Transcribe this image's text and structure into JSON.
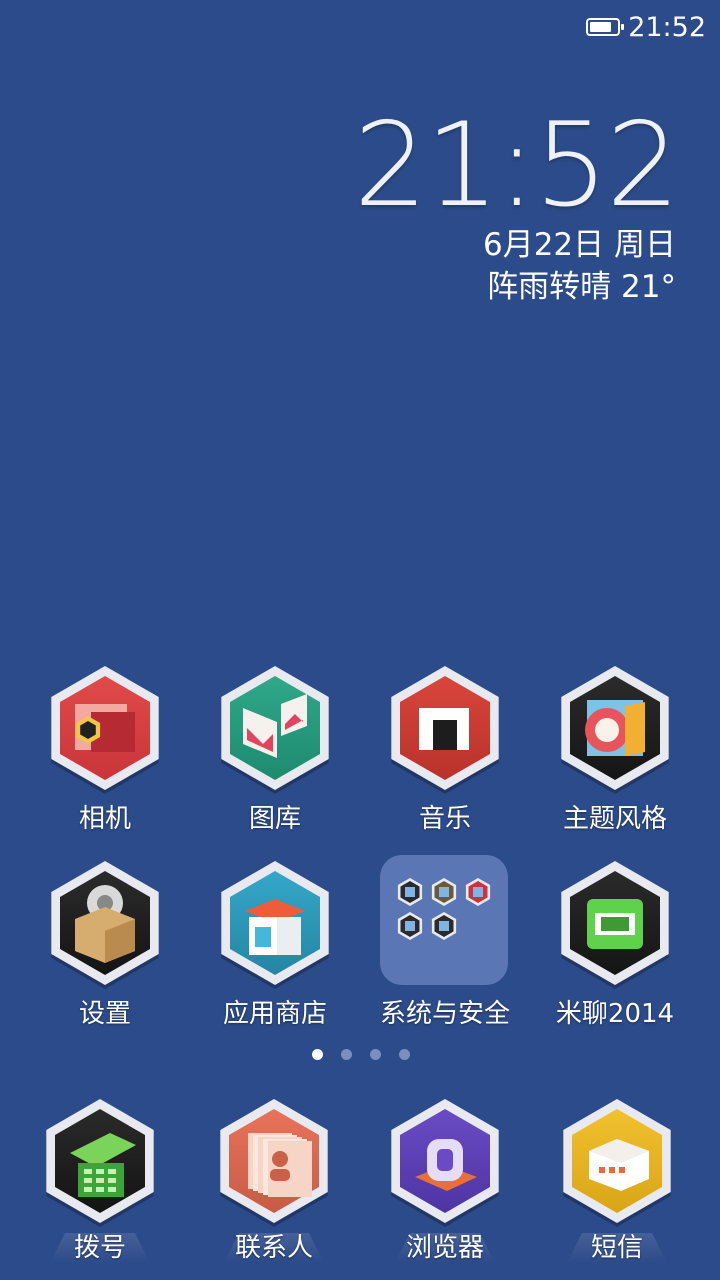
{
  "status_bar": {
    "time": "21:52",
    "battery_level": 0.85
  },
  "clock_widget": {
    "time": "21:52",
    "date": "6月22日 周日",
    "weather": "阵雨转晴  21°"
  },
  "home": {
    "rows": [
      [
        {
          "label": "相机",
          "icon": "camera-icon",
          "colors": [
            "#e04a4a",
            "#c9353a"
          ]
        },
        {
          "label": "图库",
          "icon": "gallery-icon",
          "colors": [
            "#2fa889",
            "#1e8a6f"
          ]
        },
        {
          "label": "音乐",
          "icon": "music-icon",
          "colors": [
            "#d9453b",
            "#b8322a"
          ]
        },
        {
          "label": "主题风格",
          "icon": "theme-icon",
          "colors": [
            "#2b2b2b",
            "#151515"
          ]
        }
      ],
      [
        {
          "label": "设置",
          "icon": "settings-icon",
          "colors": [
            "#2b2b2b",
            "#141414"
          ]
        },
        {
          "label": "应用商店",
          "icon": "app-store-icon",
          "colors": [
            "#35a7c9",
            "#2585a3"
          ]
        },
        {
          "label": "系统与安全",
          "icon": "folder-icon",
          "colors": [
            "#5b76b4",
            "#5b76b4"
          ]
        },
        {
          "label": "米聊2014",
          "icon": "miliao-icon",
          "colors": [
            "#2a2a2a",
            "#151515"
          ]
        }
      ]
    ],
    "page_count": 4,
    "active_page": 1
  },
  "dock": [
    {
      "label": "拨号",
      "icon": "phone-icon",
      "colors": [
        "#2a2a2a",
        "#141414"
      ]
    },
    {
      "label": "联系人",
      "icon": "contacts-icon",
      "colors": [
        "#e8735a",
        "#c85b45"
      ]
    },
    {
      "label": "浏览器",
      "icon": "browser-icon",
      "colors": [
        "#6a4bc4",
        "#4e34a3"
      ]
    },
    {
      "label": "短信",
      "icon": "messages-icon",
      "colors": [
        "#f2c12e",
        "#d8a517"
      ]
    }
  ]
}
